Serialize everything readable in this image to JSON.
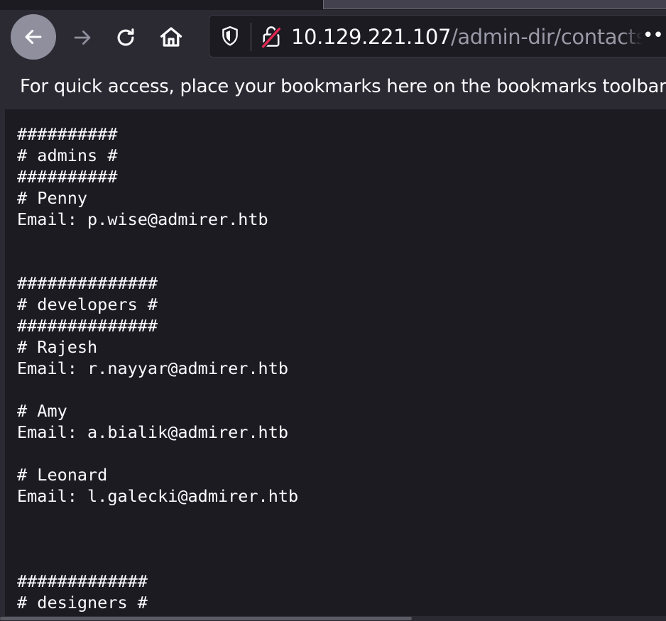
{
  "browser": {
    "icons": {
      "back": "arrow-left-icon",
      "forward": "arrow-right-icon",
      "reload": "reload-icon",
      "home": "home-icon",
      "tracking": "shield-icon",
      "insecure": "lock-strikethrough-icon",
      "more": "more-horizontal-icon"
    },
    "url": {
      "host": "10.129.221.107",
      "path": "/admin-dir/contacts.t",
      "more": "••"
    },
    "bookmarks_hint": "For quick access, place your bookmarks here on the bookmarks toolbar."
  },
  "page": {
    "lines": [
      "##########",
      "# admins #",
      "##########",
      "# Penny",
      "Email: p.wise@admirer.htb",
      "",
      "",
      "##############",
      "# developers #",
      "##############",
      "# Rajesh",
      "Email: r.nayyar@admirer.htb",
      "",
      "# Amy",
      "Email: a.bialik@admirer.htb",
      "",
      "# Leonard",
      "Email: l.galecki@admirer.htb",
      "",
      "",
      "",
      "#############",
      "# designers #",
      "#############"
    ]
  },
  "colors": {
    "toolbar": "#2b2a33",
    "content_bg": "#1c1b22",
    "text": "#fbfbfe",
    "url_path": "#9a99a6",
    "lock_slash": "#e22850"
  }
}
